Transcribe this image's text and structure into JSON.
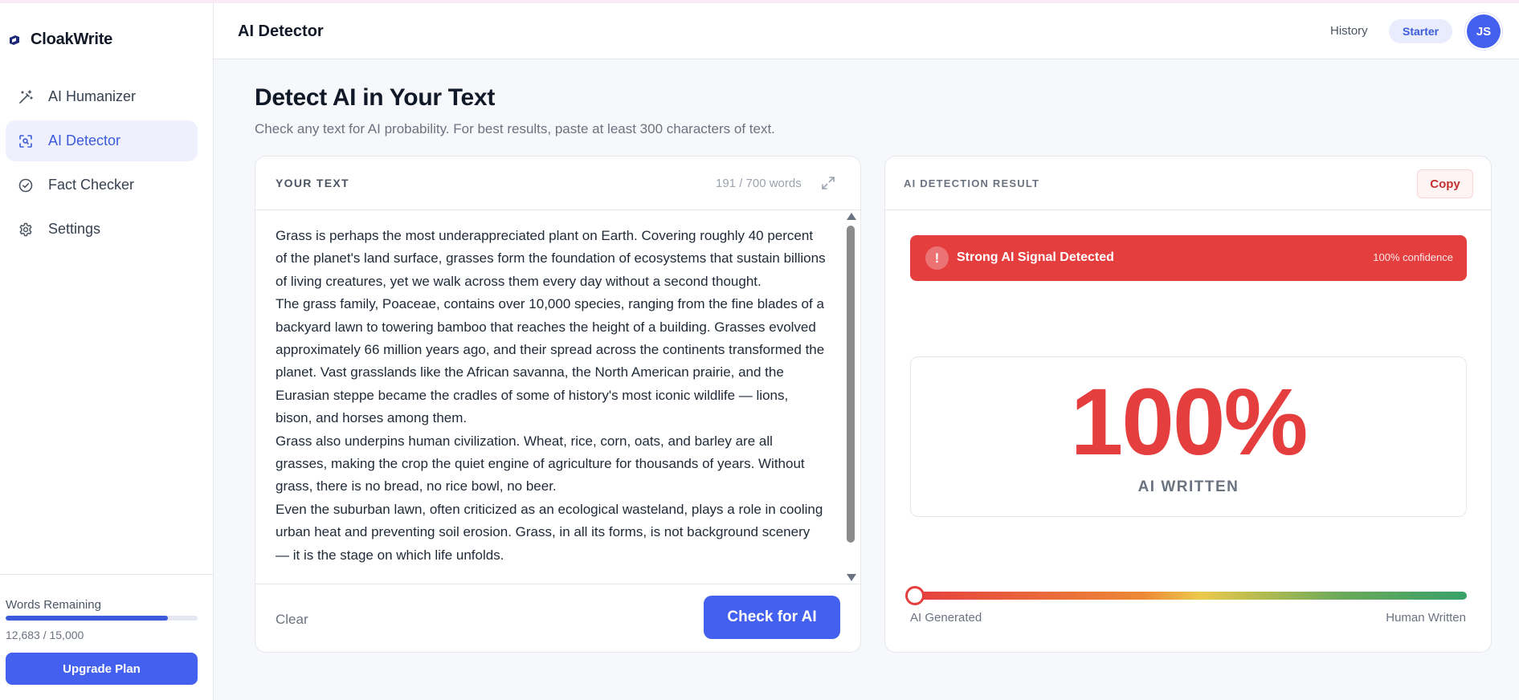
{
  "app": {
    "name": "CloakWrite",
    "logo_icon": "cloak-logo-icon",
    "brand_color": "#4361ee"
  },
  "sidebar": {
    "items": [
      {
        "label": "AI Humanizer",
        "icon": "magic-wand-icon",
        "active": false
      },
      {
        "label": "AI Detector",
        "icon": "scan-detect-icon",
        "active": true
      },
      {
        "label": "Fact Checker",
        "icon": "check-circle-icon",
        "active": false
      },
      {
        "label": "Settings",
        "icon": "gear-icon",
        "active": false
      }
    ],
    "words_remaining": {
      "label": "Words Remaining",
      "count_text": "12,683 / 15,000",
      "used_fraction": 0.8455
    },
    "upgrade_label": "Upgrade Plan"
  },
  "header": {
    "title": "AI Detector",
    "history_label": "History",
    "plan_badge": "Starter",
    "avatar_initials": "JS"
  },
  "main": {
    "title": "Detect AI in Your Text",
    "subtitle": "Check any text for AI probability. For best results, paste at least 300 characters of text.",
    "input_card": {
      "label": "YOUR TEXT",
      "word_count": "191 / 700 words",
      "expand_icon": "expand-icon",
      "paragraphs": [
        "Grass is perhaps the most underappreciated plant on Earth. Covering roughly 40 percent of the planet's land surface, grasses form the foundation of ecosystems that sustain billions of living creatures, yet we walk across them every day without a second thought.",
        "The grass family, Poaceae, contains over 10,000 species, ranging from the fine blades of a backyard lawn to towering bamboo that reaches the height of a building. Grasses evolved approximately 66 million years ago, and their spread across the continents transformed the planet. Vast grasslands like the African savanna, the North American prairie, and the Eurasian steppe became the cradles of some of history's most iconic wildlife — lions, bison, and horses among them.",
        "Grass also underpins human civilization. Wheat, rice, corn, oats, and barley are all grasses, making the crop the quiet engine of agriculture for thousands of years. Without grass, there is no bread, no rice bowl, no beer.",
        "Even the suburban lawn, often criticized as an ecological wasteland, plays a role in cooling urban heat and preventing soil erosion. Grass, in all its forms, is not background scenery — it is the stage on which life unfolds."
      ],
      "clear_label": "Clear",
      "check_label": "Check for AI"
    },
    "result_card": {
      "label": "AI DETECTION RESULT",
      "copy_label": "Copy",
      "alert": {
        "icon_text": "!",
        "title": "Strong AI Signal Detected",
        "confidence": "100% confidence",
        "color": "#e53e3e"
      },
      "score": "100%",
      "score_label": "AI WRITTEN",
      "gauge": {
        "ai_fraction": 1.0,
        "left_label": "AI Generated",
        "right_label": "Human Written"
      }
    }
  }
}
